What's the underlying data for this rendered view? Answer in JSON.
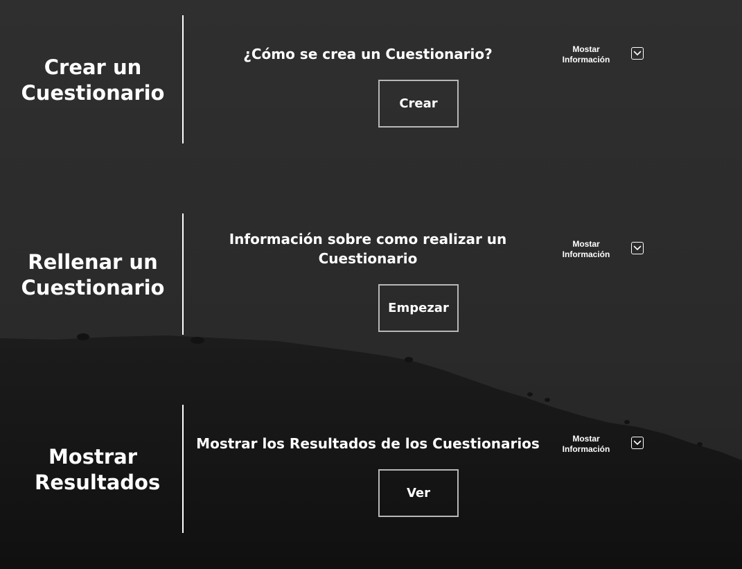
{
  "sections": [
    {
      "title": "Crear un Cuestionario",
      "question": "¿Cómo se crea un Cuestionario?",
      "button_label": "Crear",
      "info_label": "Mostar Información",
      "toggle_icon": "chevron-down-icon"
    },
    {
      "title": "Rellenar un Cuestionario",
      "question": "Información sobre como realizar un Cuestionario",
      "button_label": "Empezar",
      "info_label": "Mostar Información",
      "toggle_icon": "chevron-down-icon"
    },
    {
      "title": "Mostrar Resultados",
      "question": "Mostrar los Resultados de los Cuestionarios",
      "button_label": "Ver",
      "info_label": "Mostar Información",
      "toggle_icon": "chevron-down-icon"
    }
  ],
  "colors": {
    "sky": "#2b2b2b",
    "hill": "#151515",
    "text": "#ffffff",
    "button_border": "#b8b8b8"
  }
}
